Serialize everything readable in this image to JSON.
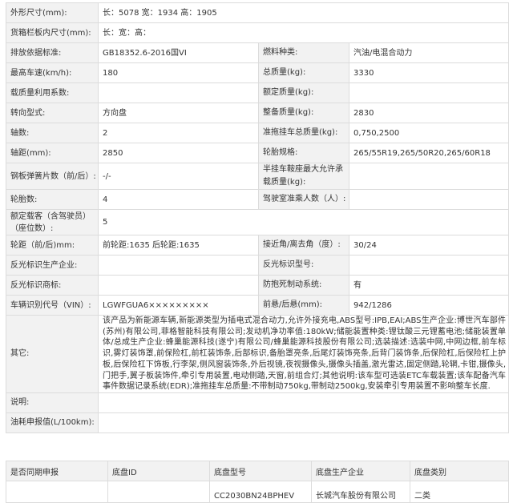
{
  "spec_rows": [
    {
      "label": "外形尺寸(mm):",
      "value": "长：5078 宽：1934 高：1905"
    },
    {
      "label": "货箱栏板内尺寸(mm):",
      "value": "长：宽：高："
    },
    {
      "label": "排放依据标准:",
      "value": "GB18352.6-2016国VI",
      "label2": "燃料种类:",
      "value2": "汽油/电混合动力"
    },
    {
      "label": "最高车速(km/h):",
      "value": "180",
      "label2": "总质量(kg):",
      "value2": "3330"
    },
    {
      "label": "载质量利用系数:",
      "value": "",
      "label2": "额定质量(kg):",
      "value2": ""
    },
    {
      "label": "转向型式:",
      "value": "方向盘",
      "label2": "整备质量(kg):",
      "value2": "2830"
    },
    {
      "label": "轴数:",
      "value": "2",
      "label2": "准拖挂车总质量(kg):",
      "value2": "0,750,2500"
    },
    {
      "label": "轴距(mm):",
      "value": "2850",
      "label2": "轮胎规格:",
      "value2": "265/55R19,265/50R20,265/60R18"
    },
    {
      "label": "钢板弹簧片数（前/后）:",
      "value": "-/-",
      "label2": "半挂车鞍座最大允许承载质量(kg):",
      "value2": ""
    },
    {
      "label": "轮胎数:",
      "value": "4",
      "label2": "驾驶室准乘人数（人）:",
      "value2": ""
    },
    {
      "label": "额定载客（含驾驶员）（座位数）:",
      "value": "5"
    },
    {
      "label": "轮距（前/后)mm:",
      "value": "前轮距:1635 后轮距:1635",
      "label2": "接近角/离去角（度）:",
      "value2": "30/24"
    },
    {
      "label": "反光标识生产企业:",
      "value": "",
      "label2": "反光标识型号:",
      "value2": ""
    },
    {
      "label": "反光标识商标:",
      "value": "",
      "label2": "防抱死制动系统:",
      "value2": "有"
    },
    {
      "label": "车辆识别代号（VIN）:",
      "value": "LGWFGUA6×××××××××",
      "label2": "前悬/后悬(mm):",
      "value2": "942/1286"
    }
  ],
  "other": {
    "label": "其它:",
    "text": "该产品为新能源车辆,新能源类型为插电式混合动力,允许外接充电,ABS型号:IPB,EAI;ABS生产企业:博世汽车部件(苏州)有限公司,菲格智能科技有限公司;发动机净功率值:180kW;储能装置种类:锂钛酸三元锂蓄电池;储能装置单体/总成生产企业:蜂巢能源科技(遂宁)有限公司/蜂巢能源科技股份有限公司;选装描述:选装中网,中网边框,前车标识,雾灯装饰罩,前保险杠,前杠装饰条,后部标识,备胎罩亮条,后尾灯装饰亮条,后背门装饰条,后保险杠,后保险杠上护板,后保险杠下饰板,行李架,侧风窗装饰条,外后视镜,夜视摄像头,摄像头插盖,激光雷达,固定侧踏,轮辋,卡钳,摄像头,门把手,翼子板装饰件,牵引专用装置,电动侧踏,天窗,前组合灯;其他说明:该车型可选装ETC车载装置;该车配备汽车事件数据记录系统(EDR);准拖挂车总质量:不带制动750kg,带制动2500kg,安装牵引专用装置不影响整车长度."
  },
  "note_label": "说明:",
  "fuel_label": "油耗申报值(L/100km):",
  "chassis": {
    "headers": [
      "是否同期申报",
      "底盘ID",
      "底盘型号",
      "底盘生产企业",
      "底盘类别"
    ],
    "row": [
      "",
      "",
      "CC2030BN24BPHEV",
      "长城汽车股份有限公司",
      "二类"
    ]
  }
}
